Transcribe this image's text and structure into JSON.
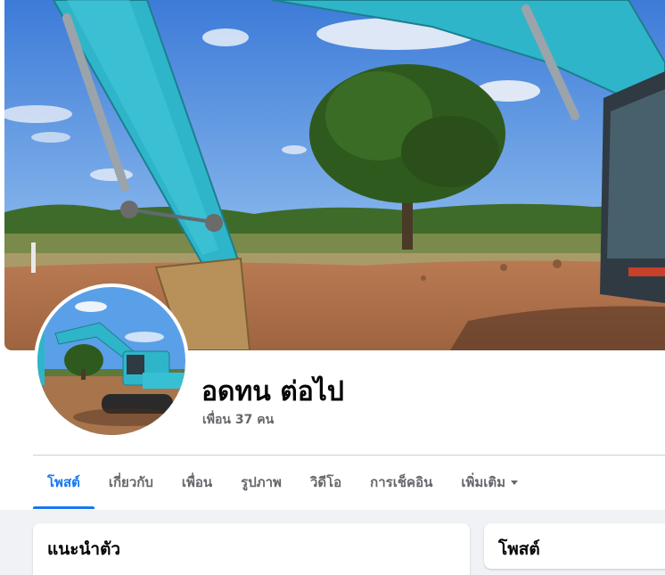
{
  "profile": {
    "name": "อดทน ต่อไป",
    "friends_label": "เพื่อน 37 คน"
  },
  "tabs": [
    {
      "label": "โพสต์",
      "active": true
    },
    {
      "label": "เกี่ยวกับ",
      "active": false
    },
    {
      "label": "เพื่อน",
      "active": false
    },
    {
      "label": "รูปภาพ",
      "active": false
    },
    {
      "label": "วิดีโอ",
      "active": false
    },
    {
      "label": "การเช็คอิน",
      "active": false
    },
    {
      "label": "เพิ่มเติม",
      "active": false,
      "icon": "caret-down-icon"
    }
  ],
  "cards": {
    "intro_title": "แนะนำตัว",
    "posts_title": "โพสต์"
  },
  "colors": {
    "accent": "#1877f2",
    "feed_background": "#f0f2f5",
    "muted_text": "#65676b"
  }
}
